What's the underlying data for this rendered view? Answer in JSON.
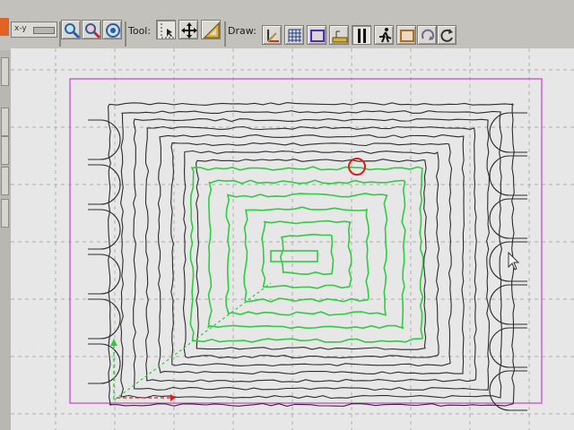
{
  "toolbar": {
    "tool_label": "Tool:",
    "draw_label": "Draw:",
    "snap_text": "x-y",
    "view_buttons": [
      {
        "icon": "zoom-in-icon"
      },
      {
        "icon": "zoom-out-icon"
      },
      {
        "icon": "zoom-fit-icon"
      }
    ],
    "tool_buttons": [
      {
        "icon": "select-cursor-icon",
        "pressed": true
      },
      {
        "icon": "move-arrows-icon",
        "pressed": false
      },
      {
        "icon": "measure-triangle-icon",
        "pressed": false
      }
    ],
    "draw_buttons": [
      {
        "icon": "axes-icon",
        "pressed": false
      },
      {
        "icon": "grid-icon",
        "pressed": false
      },
      {
        "icon": "rectangle-icon",
        "pressed": false
      },
      {
        "icon": "ruler-icon",
        "pressed": false
      },
      {
        "icon": "toolpath-icon",
        "pressed": true
      },
      {
        "icon": "runner-icon",
        "pressed": false
      },
      {
        "icon": "stock-box-icon",
        "pressed": false
      },
      {
        "icon": "rotate-view-icon",
        "pressed": false
      },
      {
        "icon": "refresh-icon",
        "pressed": false
      }
    ]
  },
  "canvas": {
    "colors": {
      "background": "#e7e7e7",
      "grid": "#9a9a9a",
      "boundary": "#d23ad6",
      "toolpath_rough": "#2c2c2c",
      "toolpath_finish": "#2ecc40",
      "marker": "#d81e1e",
      "x_axis": "#d81e1e",
      "y_axis": "#2ecc40"
    }
  }
}
